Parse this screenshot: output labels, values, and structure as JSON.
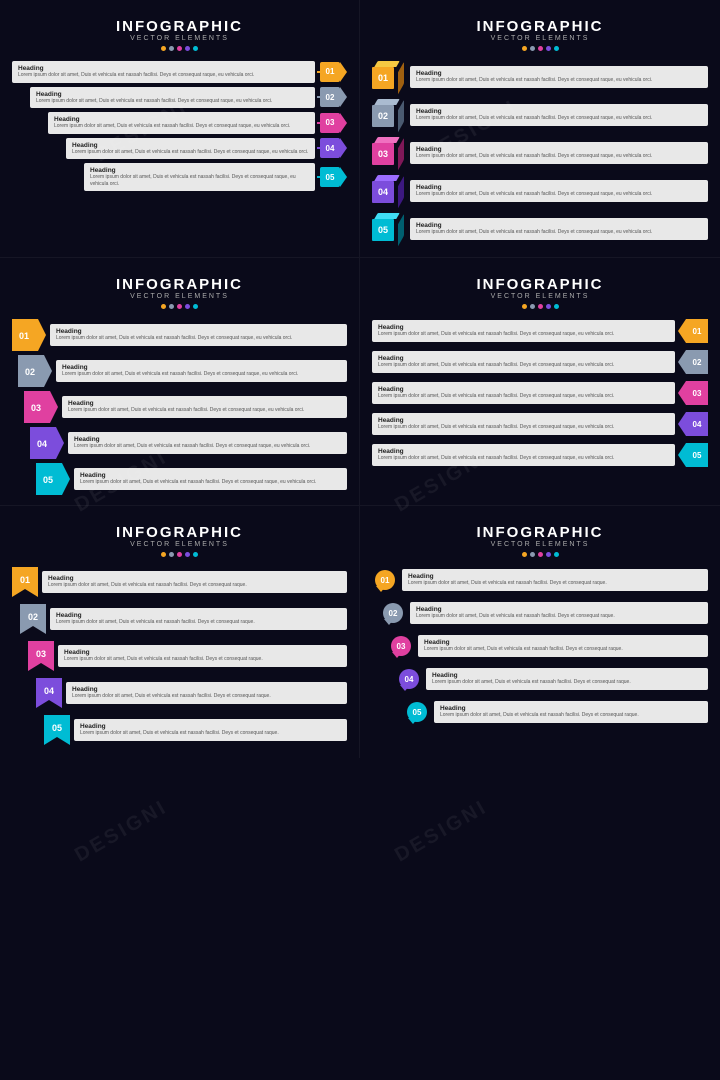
{
  "colors": {
    "bg": "#0a0a1a",
    "orange": "#f5a623",
    "orange_dark": "#d4891e",
    "orange_side": "#a06010",
    "gray": "#8a9ab0",
    "gray_dark": "#6a7a90",
    "gray_side": "#4a5a70",
    "pink": "#e040a0",
    "pink_dark": "#b02878",
    "pink_side": "#801858",
    "purple": "#7c4ddc",
    "purple_dark": "#5c2db0",
    "purple_side": "#3c1880",
    "teal": "#00bcd4",
    "teal_dark": "#008fa0",
    "teal_side": "#005f70",
    "yellow": "#f5c842",
    "yellow_dark": "#c8a020",
    "magenta": "#e040fb",
    "green": "#4caf50"
  },
  "sections": [
    {
      "id": "s1",
      "title": "INFOGRAPHIC",
      "subtitle": "VECTOR ELEMENTS",
      "dots": [
        "#f5a623",
        "#8a9ab0",
        "#e040a0",
        "#7c4ddc",
        "#00bcd4"
      ],
      "items": [
        {
          "num": "01",
          "heading": "Heading",
          "body": "Lorem ipsum dolor sit amet, Duis et vehicula est nassah facilisi. Deys et consequat raque, eu vehicula orci.",
          "color": "#f5a623"
        },
        {
          "num": "02",
          "heading": "Heading",
          "body": "Lorem ipsum dolor sit amet, Duis et vehicula est nassah facilisi. Deys et consequat raque, eu vehicula orci.",
          "color": "#8a9ab0"
        },
        {
          "num": "03",
          "heading": "Heading",
          "body": "Lorem ipsum dolor sit amet, Duis et vehicula est nassah facilisi. Deys et consequat raque, eu vehicula orci.",
          "color": "#e040a0"
        },
        {
          "num": "04",
          "heading": "Heading",
          "body": "Lorem ipsum dolor sit amet, Duis et vehicula est nassah facilisi. Deys et consequat raque, eu vehicula orci.",
          "color": "#7c4ddc"
        },
        {
          "num": "05",
          "heading": "Heading",
          "body": "Lorem ipsum dolor sit amet, Duis et vehicula est nassah facilisi. Deys et consequat raque, eu vehicula orci.",
          "color": "#00bcd4"
        }
      ]
    },
    {
      "id": "s2",
      "title": "INFOGRAPHIC",
      "subtitle": "VECTOR ELEMENTS",
      "dots": [
        "#f5a623",
        "#8a9ab0",
        "#e040a0",
        "#7c4ddc",
        "#00bcd4"
      ],
      "items": [
        {
          "num": "01",
          "heading": "Heading",
          "body": "Lorem ipsum dolor sit amet, Duis et vehicula est nassah facilisi. Deys et consequat raque, eu vehicula orci.",
          "color": "#f5a623",
          "color_dark": "#d4891e",
          "color_side": "#a06010"
        },
        {
          "num": "02",
          "heading": "Heading",
          "body": "Lorem ipsum dolor sit amet, Duis et vehicula est nassah facilisi. Deys et consequat raque, eu vehicula orci.",
          "color": "#8a9ab0",
          "color_dark": "#6a7a90",
          "color_side": "#4a5a70"
        },
        {
          "num": "03",
          "heading": "Heading",
          "body": "Lorem ipsum dolor sit amet, Duis et vehicula est nassah facilisi. Deys et consequat raque, eu vehicula orci.",
          "color": "#e040a0",
          "color_dark": "#b02878",
          "color_side": "#801858"
        },
        {
          "num": "04",
          "heading": "Heading",
          "body": "Lorem ipsum dolor sit amet, Duis et vehicula est nassah facilisi. Deys et consequat raque, eu vehicula orci.",
          "color": "#7c4ddc",
          "color_dark": "#5c2db0",
          "color_side": "#3c1880"
        },
        {
          "num": "05",
          "heading": "Heading",
          "body": "Lorem ipsum dolor sit amet, Duis et vehicula est nassah facilisi. Deys et consequat raque, eu vehicula orci.",
          "color": "#00bcd4",
          "color_dark": "#008fa0",
          "color_side": "#005f70"
        }
      ]
    },
    {
      "id": "s3",
      "title": "INFOGRAPHIC",
      "subtitle": "VECTOR ELEMENTS",
      "dots": [
        "#f5a623",
        "#8a9ab0",
        "#e040a0",
        "#7c4ddc",
        "#00bcd4"
      ],
      "items": [
        {
          "num": "01",
          "heading": "Heading",
          "body": "Lorem ipsum dolor sit amet, Duis et vehicula est nassah facilisi. Deys et consequat raque, eu vehicula orci.",
          "color": "#f5a623"
        },
        {
          "num": "02",
          "heading": "Heading",
          "body": "Lorem ipsum dolor sit amet, Duis et vehicula est nassah facilisi. Deys et consequat raque, eu vehicula orci.",
          "color": "#8a9ab0"
        },
        {
          "num": "03",
          "heading": "Heading",
          "body": "Lorem ipsum dolor sit amet, Duis et vehicula est nassah facilisi. Deys et consequat raque, eu vehicula orci.",
          "color": "#e040a0"
        },
        {
          "num": "04",
          "heading": "Heading",
          "body": "Lorem ipsum dolor sit amet, Duis et vehicula est nassah facilisi. Deys et consequat raque, eu vehicula orci.",
          "color": "#7c4ddc"
        },
        {
          "num": "05",
          "heading": "Heading",
          "body": "Lorem ipsum dolor sit amet, Duis et vehicula est nassah facilisi. Deys et consequat raque, eu vehicula orci.",
          "color": "#00bcd4"
        }
      ]
    },
    {
      "id": "s4",
      "title": "INFOGRAPHIC",
      "subtitle": "VECTOR ELEMENTS",
      "dots": [
        "#f5a623",
        "#8a9ab0",
        "#e040a0",
        "#7c4ddc",
        "#00bcd4"
      ],
      "items": [
        {
          "num": "01",
          "heading": "Heading",
          "body": "Lorem ipsum dolor sit amet, Duis et vehicula est nassah facilisi. Deys et consequat raque, eu vehicula orci.",
          "color": "#f5a623"
        },
        {
          "num": "02",
          "heading": "Heading",
          "body": "Lorem ipsum dolor sit amet, Duis et vehicula est nassah facilisi. Deys et consequat raque, eu vehicula orci.",
          "color": "#8a9ab0"
        },
        {
          "num": "03",
          "heading": "Heading",
          "body": "Lorem ipsum dolor sit amet, Duis et vehicula est nassah facilisi. Deys et consequat raque, eu vehicula orci.",
          "color": "#e040a0"
        },
        {
          "num": "04",
          "heading": "Heading",
          "body": "Lorem ipsum dolor sit amet, Duis et vehicula est nassah facilisi. Deys et consequat raque, eu vehicula orci.",
          "color": "#7c4ddc"
        },
        {
          "num": "05",
          "heading": "Heading",
          "body": "Lorem ipsum dolor sit amet, Duis et vehicula est nassah facilisi. Deys et consequat raque, eu vehicula orci.",
          "color": "#00bcd4"
        }
      ]
    },
    {
      "id": "s5",
      "title": "INFOGRAPHIC",
      "subtitle": "VECTOR ELEMENTS",
      "dots": [
        "#f5a623",
        "#8a9ab0",
        "#e040a0",
        "#7c4ddc",
        "#00bcd4"
      ],
      "items": [
        {
          "num": "01",
          "heading": "Heading",
          "body": "Lorem ipsum dolor sit amet, Duis et vehicula est nassah facilisi. Deys et consequat raque.",
          "color": "#f5a623"
        },
        {
          "num": "02",
          "heading": "Heading",
          "body": "Lorem ipsum dolor sit amet, Duis et vehicula est nassah facilisi. Deys et consequat raque.",
          "color": "#8a9ab0"
        },
        {
          "num": "03",
          "heading": "Heading",
          "body": "Lorem ipsum dolor sit amet, Duis et vehicula est nassah facilisi. Deys et consequat raque.",
          "color": "#e040a0"
        },
        {
          "num": "04",
          "heading": "Heading",
          "body": "Lorem ipsum dolor sit amet, Duis et vehicula est nassah facilisi. Deys et consequat raque.",
          "color": "#7c4ddc"
        },
        {
          "num": "05",
          "heading": "Heading",
          "body": "Lorem ipsum dolor sit amet, Duis et vehicula est nassah facilisi. Deys et consequat raque.",
          "color": "#00bcd4"
        }
      ]
    },
    {
      "id": "s6",
      "title": "INFOGRAPHIC",
      "subtitle": "VECTOR ELEMENTS",
      "dots": [
        "#f5a623",
        "#8a9ab0",
        "#e040a0",
        "#7c4ddc",
        "#00bcd4"
      ],
      "items": [
        {
          "num": "01",
          "heading": "Heading",
          "body": "Lorem ipsum dolor sit amet, Duis et vehicula est nassah facilisi. Deys et consequat raque.",
          "color": "#f5a623"
        },
        {
          "num": "02",
          "heading": "Heading",
          "body": "Lorem ipsum dolor sit amet, Duis et vehicula est nassah facilisi. Deys et consequat raque.",
          "color": "#8a9ab0"
        },
        {
          "num": "03",
          "heading": "Heading",
          "body": "Lorem ipsum dolor sit amet, Duis et vehicula est nassah facilisi. Deys et consequat raque.",
          "color": "#e040a0"
        },
        {
          "num": "04",
          "heading": "Heading",
          "body": "Lorem ipsum dolor sit amet, Duis et vehicula est nassah facilisi. Deys et consequat raque.",
          "color": "#7c4ddc"
        },
        {
          "num": "05",
          "heading": "Heading",
          "body": "Lorem ipsum dolor sit amet, Duis et vehicula est nassah facilisi. Deys et consequat raque.",
          "color": "#00bcd4"
        }
      ]
    }
  ]
}
